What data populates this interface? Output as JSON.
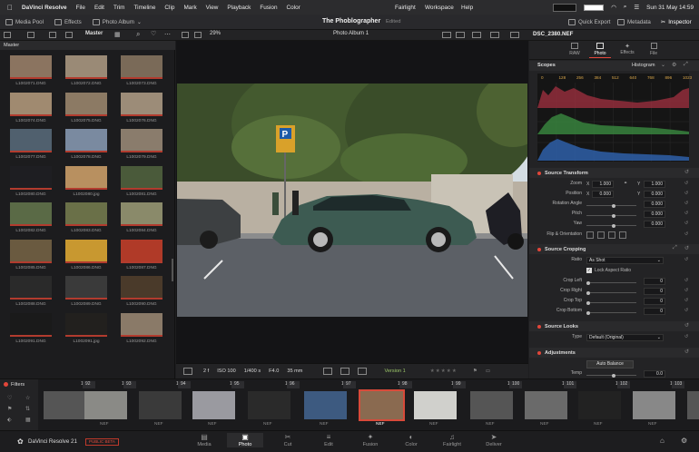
{
  "menubar": {
    "app": "DaVinci Resolve",
    "items": [
      "File",
      "Edit",
      "Trim",
      "Timeline",
      "Clip",
      "Mark",
      "View",
      "Playback",
      "Fusion",
      "Color"
    ],
    "right_items": [
      "Fairlight",
      "Workspace",
      "Help"
    ],
    "clock": "Sun 31 May 14:59"
  },
  "toolbar": {
    "media_pool": "Media Pool",
    "effects": "Effects",
    "photo_album": "Photo Album",
    "project_title": "The Phoblographer",
    "project_status": "Edited",
    "quick_export": "Quick Export",
    "metadata": "Metadata",
    "inspector": "Inspector"
  },
  "subtoolbar": {
    "master": "Master",
    "zoom": "29%",
    "album": "Photo Album 1",
    "filename": "DSC_2380.NEF"
  },
  "media": {
    "header": "Master",
    "files": [
      "L1002071.DNG",
      "L1002072.DNG",
      "L1002073.DNG",
      "L1002074.DNG",
      "L1002075.DNG",
      "L1002076.DNG",
      "L1002077.DNG",
      "L1002078.DNG",
      "L1002079.DNG",
      "L1002080.DNG",
      "L1002080.jpg",
      "L1002081.DNG",
      "L1002082.DNG",
      "L1002083.DNG",
      "L1002084.DNG",
      "L1002085.DNG",
      "L1002086.DNG",
      "L1002087.DNG",
      "L1002088.DNG",
      "L1002089.DNG",
      "L1002090.DNG",
      "L1002091.DNG",
      "L1002091.jpg",
      "L1002092.DNG"
    ],
    "thumb_colors": [
      "#8b7460",
      "#9a8a76",
      "#7a6a58",
      "#a08a70",
      "#8c7a64",
      "#9c8c78",
      "#50606e",
      "#7a8aa0",
      "#8a7c6c",
      "#1e1e22",
      "#b89060",
      "#4a5a3a",
      "#5a6a46",
      "#6a7048",
      "#8a8a6a",
      "#6a5a40",
      "#c89830",
      "#b03a28",
      "#2a2a2a",
      "#3a3a3a",
      "#4a3a2a",
      "#1a1a1a",
      "#22201e",
      "#8a7a68"
    ]
  },
  "viewer_bar": {
    "wb": "2 f",
    "iso": "ISO 100",
    "shutter": "1/400 s",
    "aperture": "F4.0",
    "focal": "35 mm",
    "version": "Version 1"
  },
  "inspector": {
    "tabs": [
      "RAW",
      "Photo",
      "Effects",
      "File"
    ],
    "active_tab": "Photo",
    "scopes_label": "Scopes",
    "histogram_label": "Histogram",
    "histogram_ticks": [
      "0",
      "128",
      "256",
      "384",
      "512",
      "640",
      "768",
      "896",
      "1023"
    ],
    "source_transform": {
      "title": "Source Transform",
      "zoom_label": "Zoom",
      "zoom_x": "1.000",
      "zoom_y": "1.000",
      "position_label": "Position",
      "pos_x": "0.000",
      "pos_y": "0.000",
      "rotation_label": "Rotation Angle",
      "rotation": "0.000",
      "pitch_label": "Pitch",
      "pitch": "0.000",
      "yaw_label": "Yaw",
      "yaw": "0.000",
      "flip_label": "Flip & Orientation",
      "x": "X",
      "y": "Y"
    },
    "source_cropping": {
      "title": "Source Cropping",
      "ratio_label": "Ratio",
      "ratio": "As Shot",
      "lock_label": "Lock Aspect Ratio",
      "crop_left_label": "Crop Left",
      "crop_left": "0",
      "crop_right_label": "Crop Right",
      "crop_right": "0",
      "crop_top_label": "Crop Top",
      "crop_top": "0",
      "crop_bottom_label": "Crop Bottom",
      "crop_bottom": "0"
    },
    "source_looks": {
      "title": "Source Looks",
      "type_label": "Type",
      "type": "Default (Original)"
    },
    "adjustments": {
      "title": "Adjustments",
      "auto_balance": "Auto Balance",
      "temp_label": "Temp",
      "temp": "0.0"
    }
  },
  "filmstrip": {
    "filters_label": "Filters",
    "group_count": "1",
    "numbers": [
      "92",
      "93",
      "94",
      "95",
      "96",
      "97",
      "98",
      "99",
      "100",
      "101",
      "102",
      "103"
    ],
    "ext": "NEF",
    "thumb_colors": [
      "#555",
      "#8a8a86",
      "#3a3a3a",
      "#9a9aa0",
      "#2a2a2a",
      "#3d5a80",
      "#8a6a50",
      "#d0d0cc",
      "#555",
      "#6a6a6a",
      "#222",
      "#888"
    ]
  },
  "pages": {
    "brand": "DaVinci Resolve 21",
    "beta": "PUBLIC BETA",
    "items": [
      "Media",
      "Photo",
      "Cut",
      "Edit",
      "Fusion",
      "Color",
      "Fairlight",
      "Deliver"
    ],
    "active": "Photo"
  }
}
